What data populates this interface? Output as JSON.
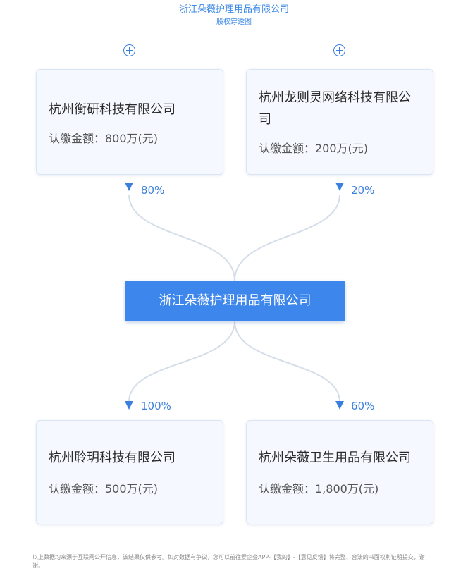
{
  "header": {
    "title": "浙江朵薇护理用品有限公司",
    "subtitle": "股权穿透图"
  },
  "center": {
    "name": "浙江朵薇护理用品有限公司"
  },
  "shareholders": [
    {
      "name": "杭州衡研科技有限公司",
      "amount": "认缴金额：800万(元)",
      "percent": "80%"
    },
    {
      "name": "杭州龙则灵网络科技有限公司",
      "amount": "认缴金额：200万(元)",
      "percent": "20%"
    }
  ],
  "investments": [
    {
      "name": "杭州聆玥科技有限公司",
      "amount": "认缴金额：500万(元)",
      "percent": "100%"
    },
    {
      "name": "杭州朵薇卫生用品有限公司",
      "amount": "认缴金额：1,800万(元)",
      "percent": "60%"
    }
  ],
  "colors": {
    "accent": "#3d86ec",
    "line": "#d5dde8",
    "card_bg": "#f5f9ff"
  },
  "icons": {
    "expand": "plus-circle-icon",
    "arrow": "arrow-down-icon"
  },
  "disclaimer": "以上数据均来源于互联网公开信息，该结果仅供参考。如对数据有争议，您可以前往爱企查APP-【我的】-【意见反馈】将完整、合法的书面权利证明提交，谢谢。"
}
